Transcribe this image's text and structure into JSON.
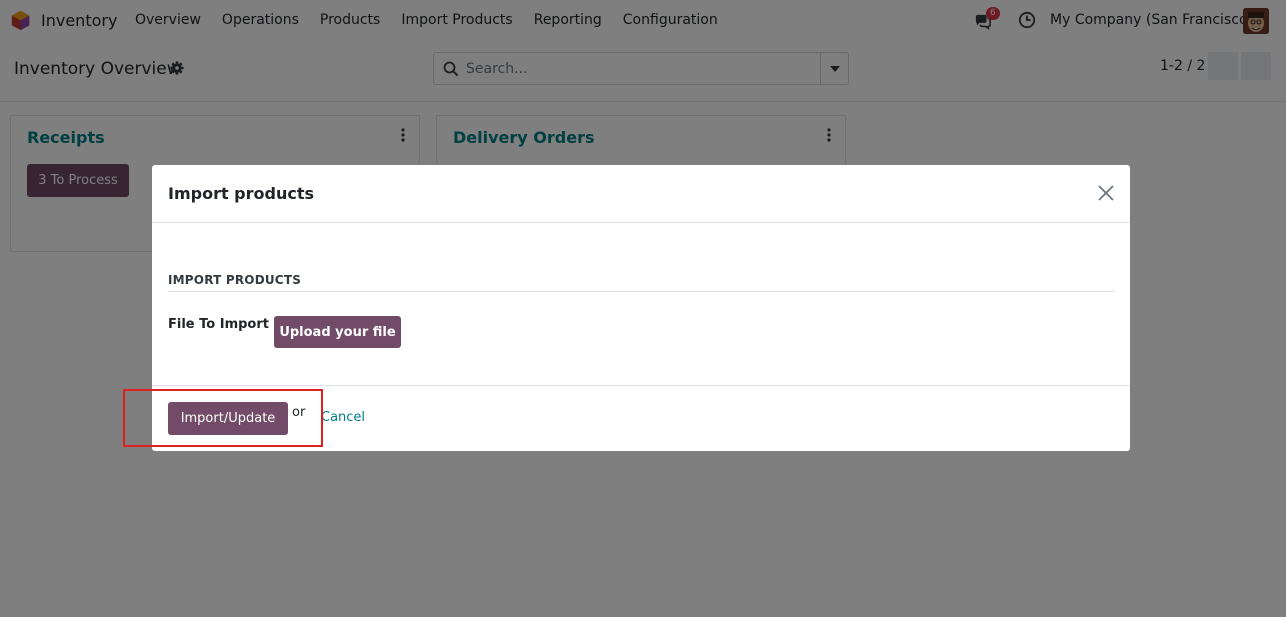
{
  "navbar": {
    "app_name": "Inventory",
    "menu": [
      "Overview",
      "Operations",
      "Products",
      "Import Products",
      "Reporting",
      "Configuration"
    ],
    "message_count": "6",
    "company": "My Company (San Francisco)"
  },
  "control_panel": {
    "title": "Inventory Overview",
    "search_placeholder": "Search...",
    "pager": "1-2 / 2"
  },
  "cards": [
    {
      "title": "Receipts",
      "button": "3 To Process"
    },
    {
      "title": "Delivery Orders"
    }
  ],
  "modal": {
    "title": "Import products",
    "section_title": "IMPORT PRODUCTS",
    "field_label": "File To Import",
    "upload_button": "Upload your file",
    "import_button": "Import/Update",
    "or_text": "or",
    "cancel_link": "Cancel"
  },
  "colors": {
    "brand": "#714b67",
    "link": "#017e84",
    "badge": "#dc3545",
    "highlight": "#e0201f"
  }
}
